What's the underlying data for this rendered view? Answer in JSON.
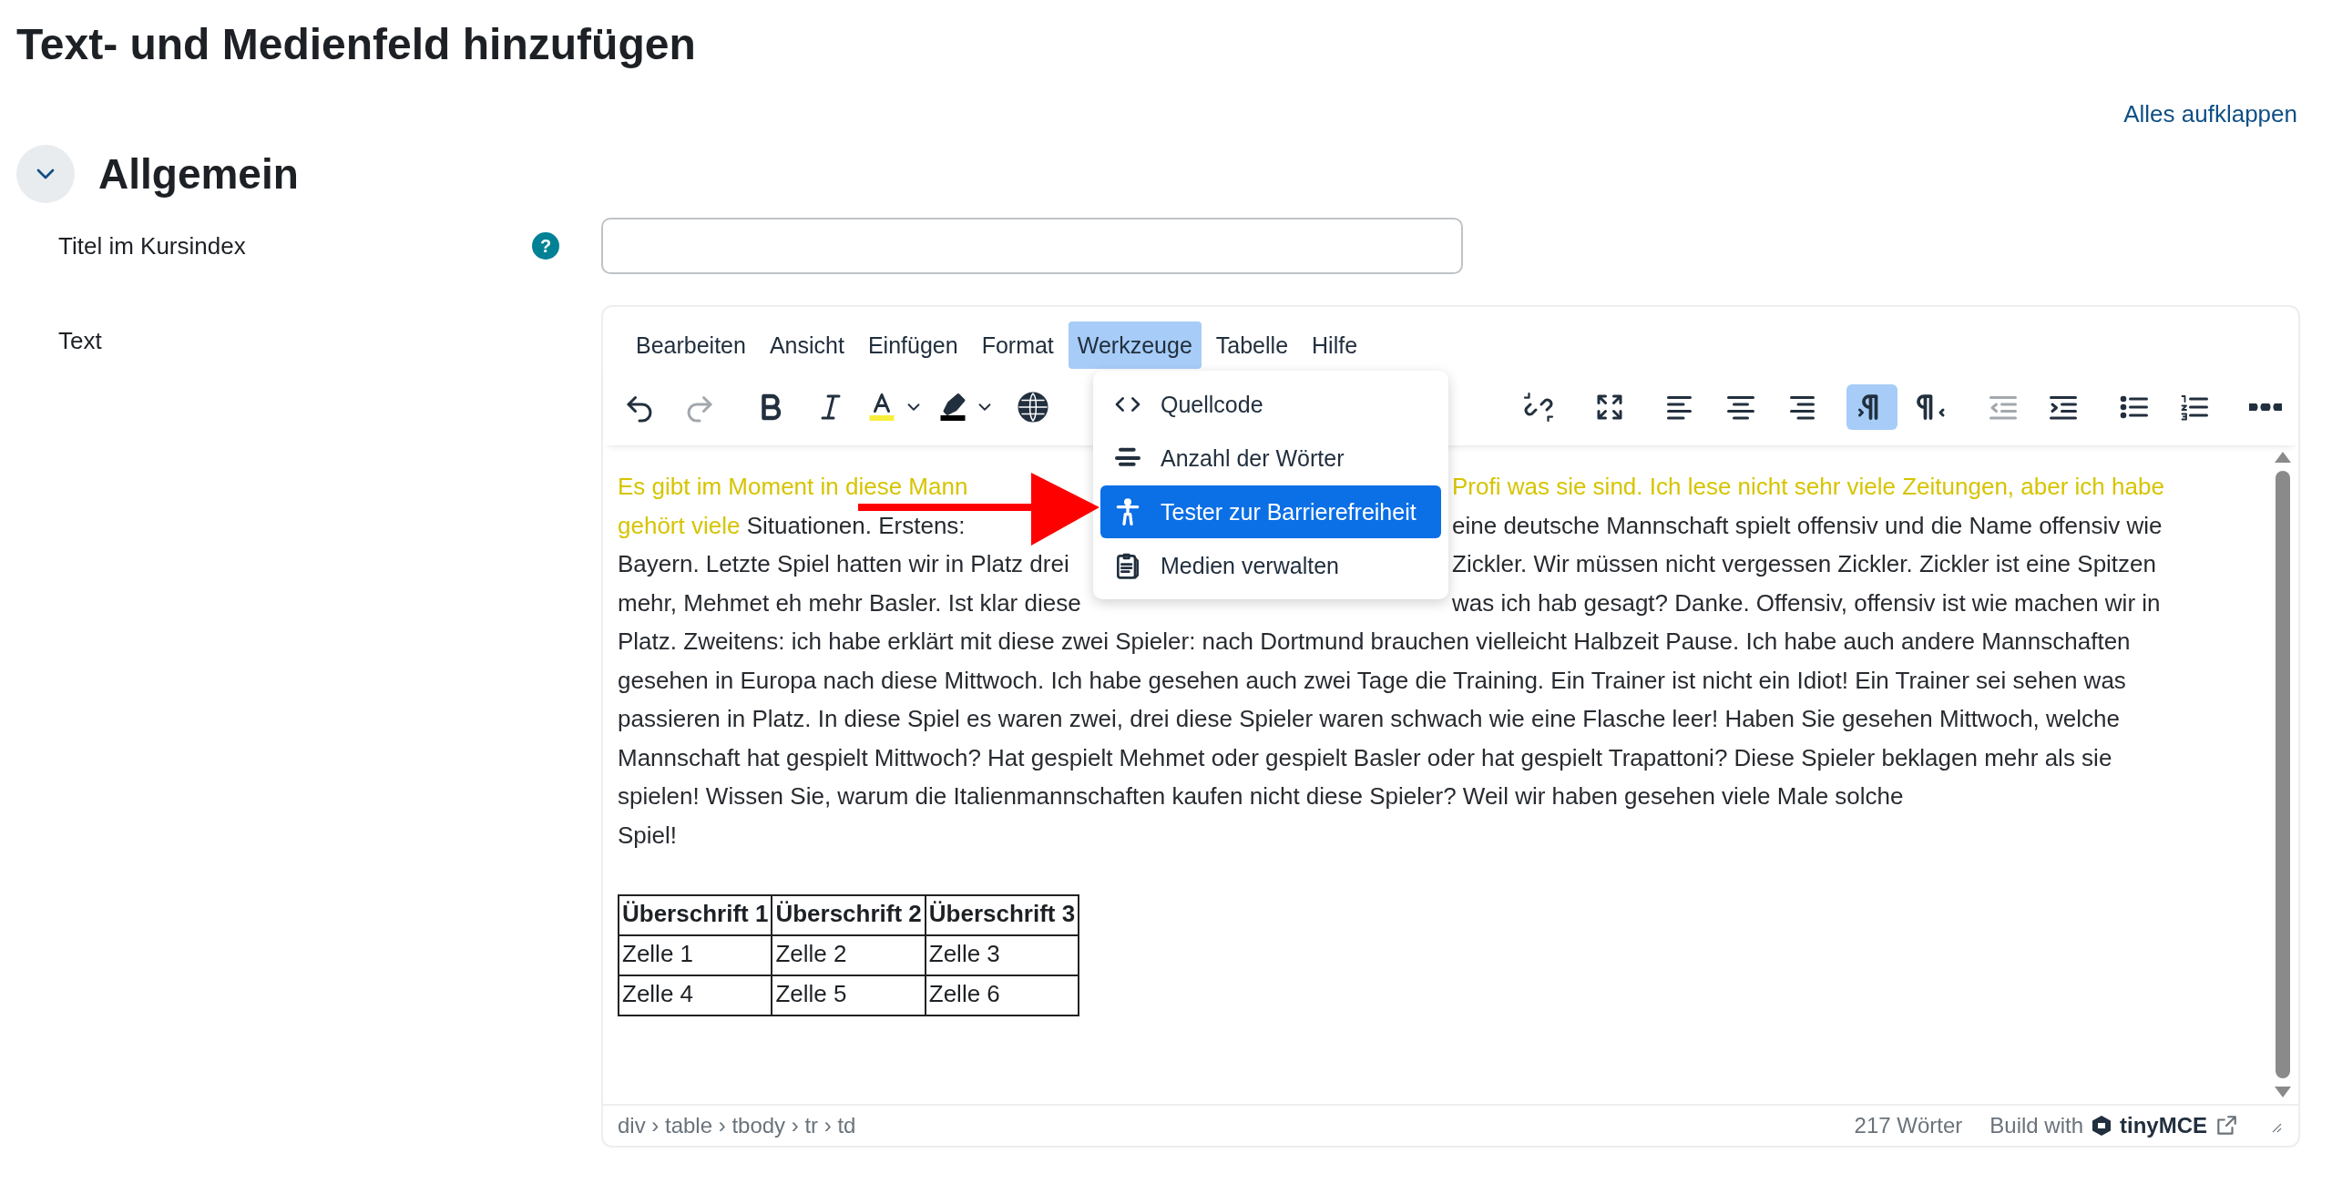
{
  "page_title": "Text- und Medienfeld hinzufügen",
  "expand_all": "Alles aufklappen",
  "section": {
    "title": "Allgemein",
    "expanded": true
  },
  "title_row": {
    "label": "Titel im Kursindex",
    "help": "?"
  },
  "text_row": {
    "label": "Text"
  },
  "editor": {
    "menubar": [
      {
        "label": "Bearbeiten",
        "selected": false
      },
      {
        "label": "Ansicht",
        "selected": false
      },
      {
        "label": "Einfügen",
        "selected": false
      },
      {
        "label": "Format",
        "selected": false
      },
      {
        "label": "Werkzeuge",
        "selected": true
      },
      {
        "label": "Tabelle",
        "selected": false
      },
      {
        "label": "Hilfe",
        "selected": false
      }
    ],
    "toolbar": [
      [
        {
          "kind": "undo",
          "disabled": false,
          "active": false
        },
        {
          "kind": "redo",
          "disabled": true,
          "active": false
        }
      ],
      [
        {
          "kind": "bold",
          "disabled": false,
          "active": false
        },
        {
          "kind": "italic",
          "disabled": false,
          "active": false
        },
        {
          "kind": "text-color",
          "disabled": false,
          "active": false
        },
        {
          "kind": "highlight",
          "disabled": false,
          "active": false
        },
        {
          "kind": "globe",
          "disabled": false,
          "active": false
        }
      ],
      [
        {
          "kind": "unlink",
          "disabled": false,
          "active": false
        }
      ],
      [
        {
          "kind": "fullscreen",
          "disabled": false,
          "active": false
        }
      ],
      [
        {
          "kind": "align-left",
          "disabled": false,
          "active": false
        },
        {
          "kind": "align-center",
          "disabled": false,
          "active": false
        },
        {
          "kind": "align-right",
          "disabled": false,
          "active": false
        }
      ],
      [
        {
          "kind": "ltr",
          "disabled": false,
          "active": true
        },
        {
          "kind": "rtl",
          "disabled": false,
          "active": false
        }
      ],
      [
        {
          "kind": "outdent",
          "disabled": true,
          "active": false
        },
        {
          "kind": "indent",
          "disabled": false,
          "active": false
        }
      ],
      [
        {
          "kind": "bullet-list",
          "disabled": false,
          "active": false
        },
        {
          "kind": "numbered-list",
          "disabled": false,
          "active": false
        }
      ],
      [
        {
          "kind": "more",
          "disabled": false,
          "active": false
        }
      ]
    ],
    "lines": [
      {
        "left": [
          {
            "text": "Es gibt im Moment in diese Mann",
            "color": "#d6c400"
          }
        ],
        "right": [
          {
            "text": "Profi was sie sind. Ich lese nicht sehr viele Zeitungen, aber ich habe",
            "color": "#d6c400"
          }
        ]
      },
      {
        "left": [
          {
            "text": "gehört viele ",
            "color": "#d6c400"
          },
          {
            "text": "Situationen. Erstens:",
            "color": "#272b30"
          }
        ],
        "right": [
          {
            "text": "eine deutsche Mannschaft spielt offensiv und die Name offensiv wie",
            "color": "#272b30"
          }
        ]
      },
      {
        "left": [
          {
            "text": "Bayern. Letzte Spiel hatten wir in Platz drei",
            "color": "#272b30"
          }
        ],
        "right": [
          {
            "text": "Zickler. Wir müssen nicht vergessen Zickler. Zickler ist eine Spitzen",
            "color": "#272b30"
          }
        ]
      },
      {
        "left": [
          {
            "text": "mehr, Mehmet eh mehr Basler. Ist klar diese",
            "color": "#272b30"
          }
        ],
        "right": [
          {
            "text": "was ich hab gesagt? Danke. Offensiv, offensiv ist wie machen wir in",
            "color": "#272b30"
          }
        ]
      },
      {
        "left": [
          {
            "text": "Platz. Zweitens: ich habe erklärt mit diese zwei Spieler: nach Dortmund brauchen vielleicht Halbzeit Pause. Ich habe auch andere Mannschaften",
            "color": "#272b30"
          }
        ]
      },
      {
        "left": [
          {
            "text": "gesehen in Europa nach diese Mittwoch. Ich habe gesehen auch zwei Tage die Training. Ein Trainer ist nicht ein Idiot! Ein Trainer sei sehen was",
            "color": "#272b30"
          }
        ]
      },
      {
        "left": [
          {
            "text": "passieren in Platz. In diese Spiel es waren zwei, drei diese Spieler waren schwach wie eine Flasche leer! Haben Sie gesehen Mittwoch, welche",
            "color": "#272b30"
          }
        ]
      },
      {
        "left": [
          {
            "text": "Mannschaft hat gespielt Mittwoch? Hat gespielt Mehmet oder gespielt Basler oder hat gespielt Trapattoni? Diese Spieler beklagen mehr als sie",
            "color": "#272b30"
          }
        ]
      },
      {
        "left": [
          {
            "text": "spielen! Wissen Sie, warum die Italienmannschaften kaufen nicht diese Spieler? Weil wir haben gesehen viele Male solche",
            "color": "#272b30"
          }
        ]
      },
      {
        "left": [
          {
            "text": "Spiel!",
            "color": "#272b30"
          }
        ]
      }
    ],
    "table": {
      "columns": [
        "Überschrift 1",
        "Überschrift 2",
        "Überschrift 3"
      ],
      "rows": [
        [
          "Zelle 1",
          "Zelle 2",
          "Zelle 3"
        ],
        [
          "Zelle 4",
          "Zelle 5",
          "Zelle 6"
        ]
      ]
    },
    "status": {
      "path": "div › table › tbody › tr › td",
      "word_count": "217 Wörter",
      "build_with": "Build with",
      "brand": "tinyMCE"
    },
    "dropdown": [
      {
        "kind": "code",
        "label": "Quellcode",
        "selected": false
      },
      {
        "kind": "word-count",
        "label": "Anzahl der Wörter",
        "selected": false
      },
      {
        "kind": "accessibility",
        "label": "Tester zur Barrierefreiheit",
        "selected": true
      },
      {
        "kind": "media",
        "label": "Medien verwalten",
        "selected": false
      }
    ]
  }
}
